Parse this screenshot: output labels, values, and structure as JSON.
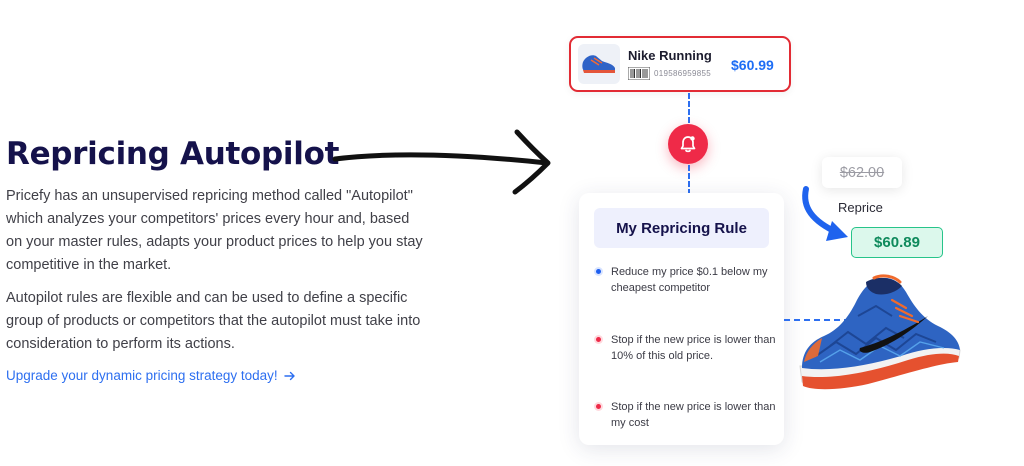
{
  "hero": {
    "title": "Repricing Autopilot",
    "paragraph1": "Pricefy has an unsupervised repricing method called \"Autopilot\" which analyzes your competitors' prices every hour and, based on your master rules, adapts your product prices to help you stay competitive in the market.",
    "paragraph2": "Autopilot rules are flexible and can be used to define a specific group of products or competitors that the autopilot must take into consideration to perform its actions.",
    "cta_label": "Upgrade your dynamic pricing strategy today!"
  },
  "product": {
    "name": "Nike Running",
    "code": "019586959855",
    "price": "$60.99"
  },
  "rule_card": {
    "title": "My Repricing Rule",
    "items": [
      "Reduce my price $0.1 below my cheapest competitor",
      "Stop if the new price is lower than 10% of this old price.",
      "Stop if the new price is lower than my cost"
    ]
  },
  "reprice": {
    "old_price": "$62.00",
    "label": "Reprice",
    "new_price": "$60.89"
  },
  "colors": {
    "title": "#15124b",
    "link": "#2d6ff0",
    "alert_red": "#ef2a48",
    "price_blue": "#1e6ef5",
    "new_price_green": "#0f8a5c"
  },
  "icons": [
    "hand-drawn-arrow-icon",
    "shoe-thumbnail-icon",
    "barcode-icon",
    "bell-icon",
    "arrow-right-icon",
    "curved-arrow-icon",
    "shoe-illustration"
  ]
}
